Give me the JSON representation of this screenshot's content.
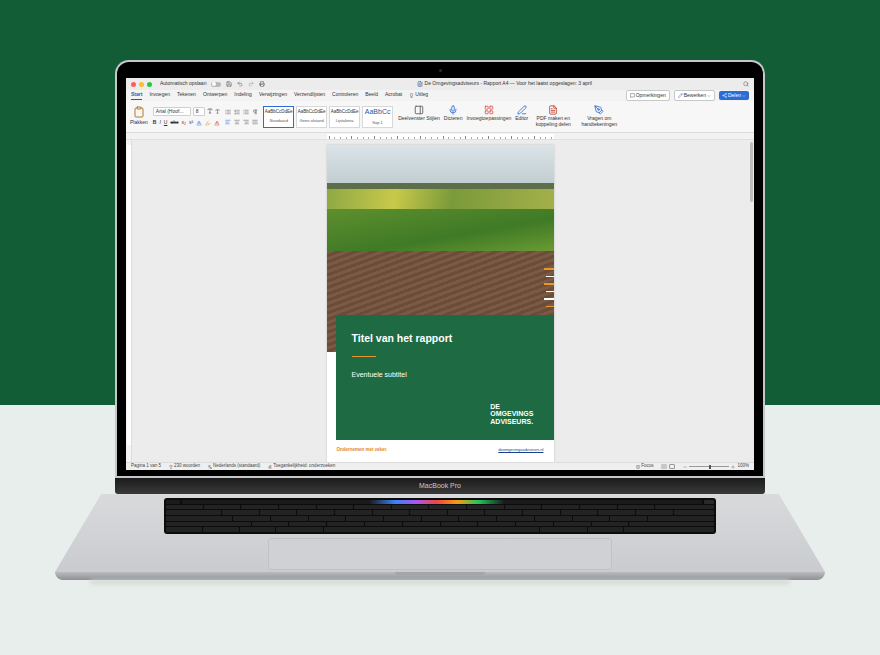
{
  "laptop": {
    "label": "MacBook Pro"
  },
  "window": {
    "title": "De Omgevingsadviseurs - Rapport A4 — Voor het laatst opgeslagen: 3 april",
    "autosave": {
      "label": "Automatisch opslaan",
      "on": false
    }
  },
  "tabs": [
    {
      "label": "Start",
      "selected": true
    },
    {
      "label": "Invoegen",
      "selected": false
    },
    {
      "label": "Tekenen",
      "selected": false
    },
    {
      "label": "Ontwerpen",
      "selected": false
    },
    {
      "label": "Indeling",
      "selected": false
    },
    {
      "label": "Verwijzingen",
      "selected": false
    },
    {
      "label": "Verzendlijsten",
      "selected": false
    },
    {
      "label": "Controleren",
      "selected": false
    },
    {
      "label": "Beeld",
      "selected": false
    },
    {
      "label": "Acrobat",
      "selected": false
    },
    {
      "label": "Uitleg",
      "selected": false
    }
  ],
  "header_buttons": [
    {
      "label": "Opmerkingen",
      "kind": "outline"
    },
    {
      "label": "Bewerken",
      "kind": "menu"
    },
    {
      "label": "Delen",
      "kind": "primary"
    }
  ],
  "ribbon": {
    "paste": "Plakken",
    "font": "Arial (Hoof...",
    "size": "8",
    "format": [
      "B",
      "I",
      "U",
      "abc",
      "x₂",
      "x²"
    ],
    "styles": [
      {
        "sample": "AaBbCcDdEe",
        "name": "Standaard",
        "selected": true,
        "kind": "body"
      },
      {
        "sample": "AaBbCcDdEe",
        "name": "Geen afstand",
        "selected": false,
        "kind": "body"
      },
      {
        "sample": "AaBbCcDdEe",
        "name": "Lijstalinea",
        "selected": false,
        "kind": "body"
      },
      {
        "sample": "AaBbCc",
        "name": "Kop 1",
        "selected": false,
        "kind": "heading"
      }
    ],
    "tools": [
      "Deelvenster Stijlen",
      "Dicteren",
      "Invoegtoepassingen",
      "Editor",
      "PDF maken en koppeling delen",
      "Vragen om handtekeningen"
    ]
  },
  "document": {
    "title": "Titel van het rapport",
    "subtitle": "Eventuele subtitel",
    "logo": [
      "DE",
      "OMGEVINGS",
      "ADVISEURS."
    ],
    "tagline": "Ondernemen met zeker.",
    "website": "deomgevingsadviseurs.nl"
  },
  "status_bar": {
    "items": [
      "Pagina 1 van 5",
      "230 woorden",
      "Nederlands (standaard)",
      "Toegankelijkheid: onderzoeken"
    ],
    "focus": "Focus",
    "zoom": {
      "level": 0.5,
      "reading": "100%"
    }
  }
}
